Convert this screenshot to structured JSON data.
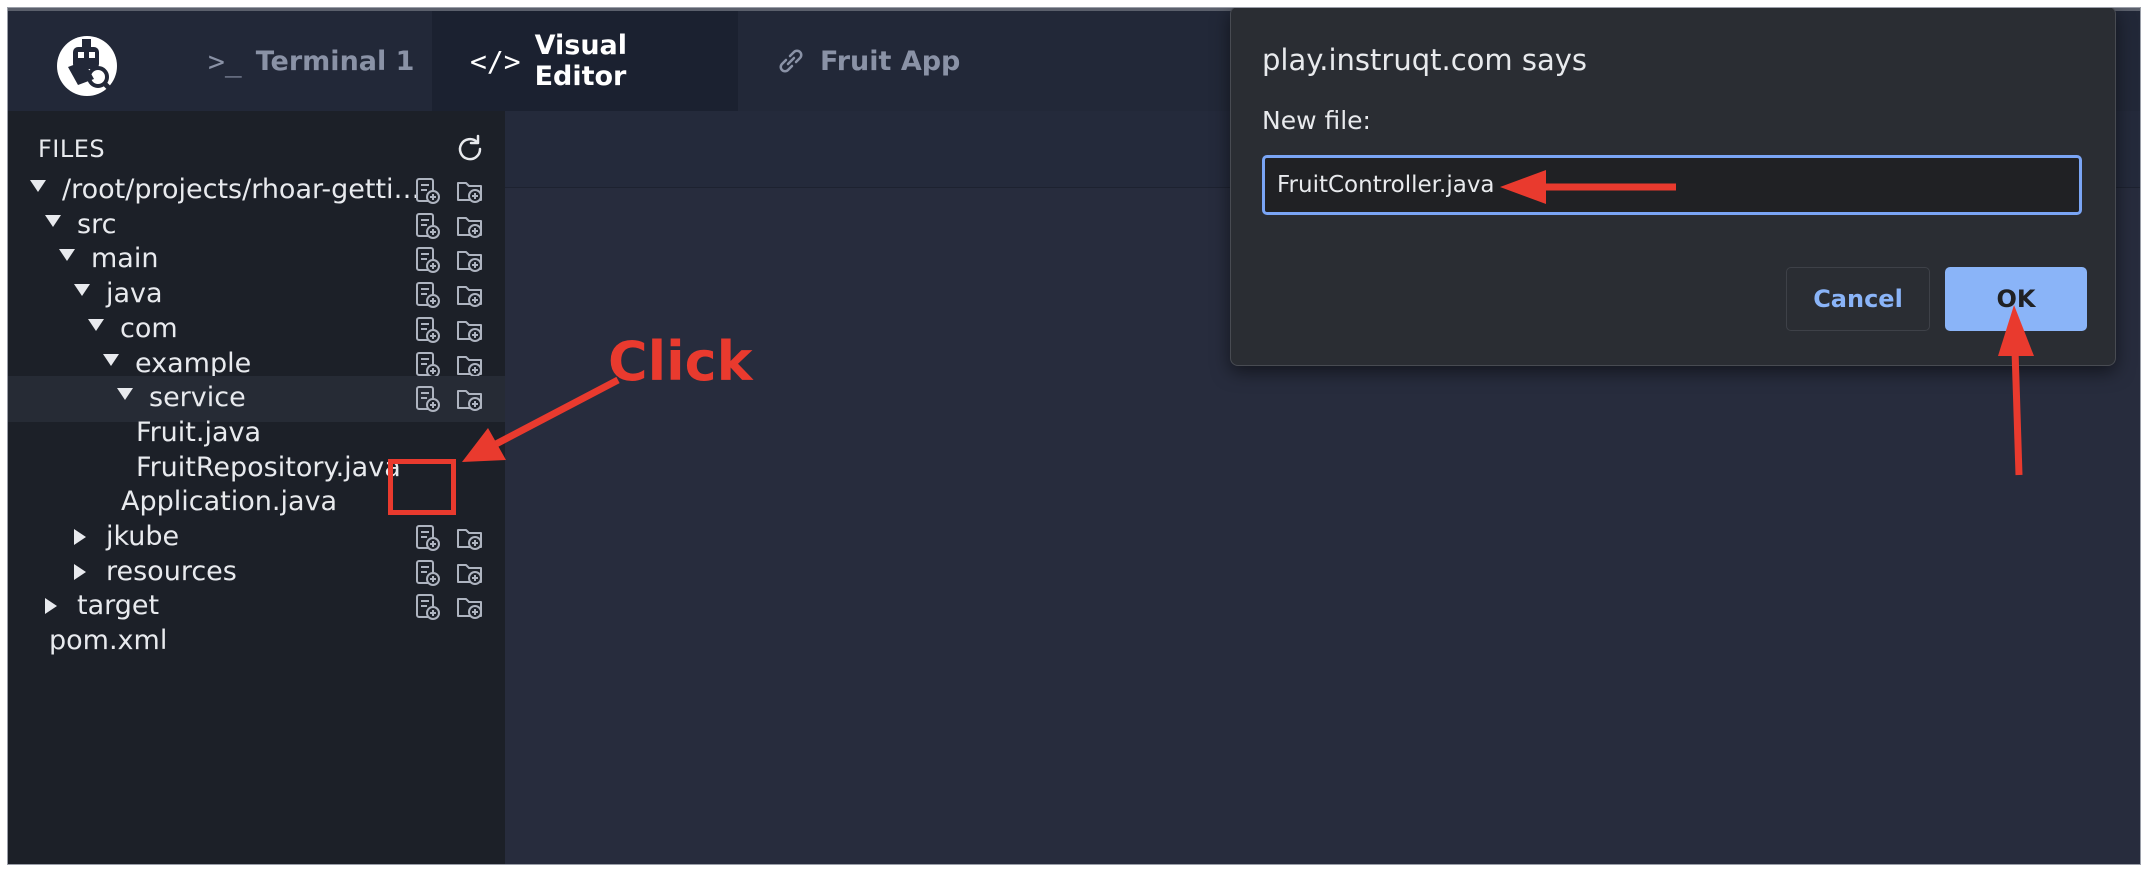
{
  "tabs": [
    {
      "label": "Terminal 1",
      "icon": "terminal-icon",
      "active": false
    },
    {
      "label": "Visual Editor",
      "icon": "code-icon",
      "active": true
    },
    {
      "label": "Fruit App",
      "icon": "link-icon",
      "active": false
    }
  ],
  "sidebar": {
    "title": "FILES",
    "tree": [
      {
        "label": "/root/projects/rhoar-getti…",
        "arrow": "down",
        "actions": true
      },
      {
        "label": "src",
        "arrow": "down",
        "actions": true
      },
      {
        "label": "main",
        "arrow": "down",
        "actions": true
      },
      {
        "label": "java",
        "arrow": "down",
        "actions": true
      },
      {
        "label": "com",
        "arrow": "down",
        "actions": true
      },
      {
        "label": "example",
        "arrow": "down",
        "actions": true
      },
      {
        "label": "service",
        "arrow": "down",
        "actions": true,
        "selected": true
      },
      {
        "label": "Fruit.java",
        "arrow": "none",
        "actions": false
      },
      {
        "label": "FruitRepository.java",
        "arrow": "none",
        "actions": false
      },
      {
        "label": "Application.java",
        "arrow": "none",
        "actions": false
      },
      {
        "label": "jkube",
        "arrow": "right",
        "actions": true
      },
      {
        "label": "resources",
        "arrow": "right",
        "actions": true
      },
      {
        "label": "target",
        "arrow": "right",
        "actions": true
      },
      {
        "label": "pom.xml",
        "arrow": "none",
        "actions": false
      }
    ]
  },
  "dialog": {
    "title": "play.instruqt.com says",
    "label": "New file:",
    "input_value": "FruitController.java",
    "cancel_label": "Cancel",
    "ok_label": "OK"
  },
  "annotation": {
    "click_label": "Click",
    "color": "#e93a2e"
  },
  "colors": {
    "accent": "#8ab4f8",
    "sidebar_bg": "#1c2028",
    "editor_bg": "#272c3d"
  }
}
